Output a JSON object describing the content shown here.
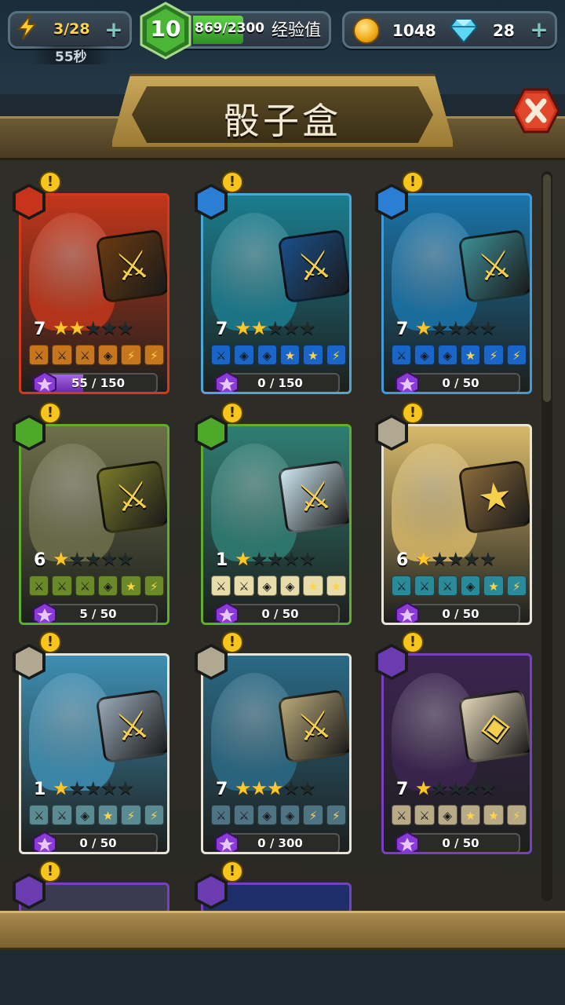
{
  "hud": {
    "energy": "3/28",
    "energy_timer": "55秒",
    "level": "10",
    "xp": "869/2300",
    "xp_label": "经验值",
    "xp_fraction": 0.378,
    "coins": "1048",
    "gems": "28"
  },
  "title": "骰子盒",
  "cards": [
    {
      "element": "fire",
      "level": "7",
      "stars": 2,
      "progress": "55 / 150",
      "fraction": 0.37,
      "bg": "#c2361a",
      "border": "#d13a1b",
      "faces": [
        "⚔",
        "⚔",
        "⚔",
        "◈",
        "⚡",
        "⚡"
      ],
      "face_bg": "#c8761e",
      "die_bg": "#6a3a10",
      "die_glyph": "⚔"
    },
    {
      "element": "water",
      "level": "7",
      "stars": 2,
      "progress": "0 / 150",
      "fraction": 0,
      "bg": "#1b7d8f",
      "border": "#4aa8d9",
      "faces": [
        "⚔",
        "◈",
        "◈",
        "★",
        "★",
        "⚡"
      ],
      "face_bg": "#1a66c8",
      "die_bg": "#1a4f8a",
      "die_glyph": "⚔"
    },
    {
      "element": "water",
      "level": "7",
      "stars": 1,
      "progress": "0 / 50",
      "fraction": 0,
      "bg": "#1a74a9",
      "border": "#3f9ad6",
      "faces": [
        "⚔",
        "◈",
        "◈",
        "★",
        "⚡",
        "⚡"
      ],
      "face_bg": "#1a66c8",
      "die_bg": "#3d8e96",
      "die_glyph": "⚔"
    },
    {
      "element": "nature",
      "level": "6",
      "stars": 1,
      "progress": "5 / 50",
      "fraction": 0.1,
      "bg": "#6e6f4a",
      "border": "#5fae2d",
      "faces": [
        "⚔",
        "⚔",
        "⚔",
        "◈",
        "★",
        "⚡"
      ],
      "face_bg": "#6a8a2a",
      "die_bg": "#7a7a2a",
      "die_glyph": "⚔"
    },
    {
      "element": "nature",
      "level": "1",
      "stars": 1,
      "progress": "0 / 50",
      "fraction": 0,
      "bg": "#2f7e74",
      "border": "#5fae2d",
      "faces": [
        "⚔",
        "⚔",
        "◈",
        "◈",
        "★",
        "★"
      ],
      "face_bg": "#e8dcaa",
      "die_bg": "#cfe8f2",
      "die_glyph": "⚔"
    },
    {
      "element": "air",
      "level": "6",
      "stars": 1,
      "progress": "0 / 50",
      "fraction": 0,
      "bg": "#d8b96a",
      "border": "#e8e4d8",
      "faces": [
        "⚔",
        "⚔",
        "⚔",
        "◈",
        "★",
        "⚡"
      ],
      "face_bg": "#2a8a9a",
      "die_bg": "#8a6a3a",
      "die_glyph": "★"
    },
    {
      "element": "air",
      "level": "1",
      "stars": 1,
      "progress": "0 / 50",
      "fraction": 0,
      "bg": "#3e8fb4",
      "border": "#e8e4d8",
      "faces": [
        "⚔",
        "⚔",
        "◈",
        "★",
        "⚡",
        "⚡"
      ],
      "face_bg": "#5a8a92",
      "die_bg": "#9aaab8",
      "die_glyph": "⚔"
    },
    {
      "element": "air",
      "level": "7",
      "stars": 3,
      "progress": "0 / 300",
      "fraction": 0,
      "bg": "#2a6a86",
      "border": "#e8e4d8",
      "faces": [
        "⚔",
        "⚔",
        "◈",
        "◈",
        "⚡",
        "⚡"
      ],
      "face_bg": "#4e7484",
      "die_bg": "#b8a878",
      "die_glyph": "⚔"
    },
    {
      "element": "dark",
      "level": "7",
      "stars": 1,
      "progress": "0 / 50",
      "fraction": 0,
      "bg": "#3b2450",
      "border": "#7a3ec0",
      "faces": [
        "⚔",
        "⚔",
        "◈",
        "★",
        "★",
        "⚡"
      ],
      "face_bg": "#b8aa86",
      "die_bg": "#e2d6b8",
      "die_glyph": "◈"
    }
  ],
  "partial_cards": [
    {
      "element": "dark",
      "bg": "#3a3a52",
      "border": "#7a3ec0"
    },
    {
      "element": "dark",
      "bg": "#1e2e6a",
      "border": "#7a3ec0"
    }
  ],
  "colors": {
    "fire": "#c8331c",
    "water": "#2a7fd4",
    "nature": "#4ea82a",
    "air": "#b0a890",
    "dark": "#6a3cb0"
  }
}
